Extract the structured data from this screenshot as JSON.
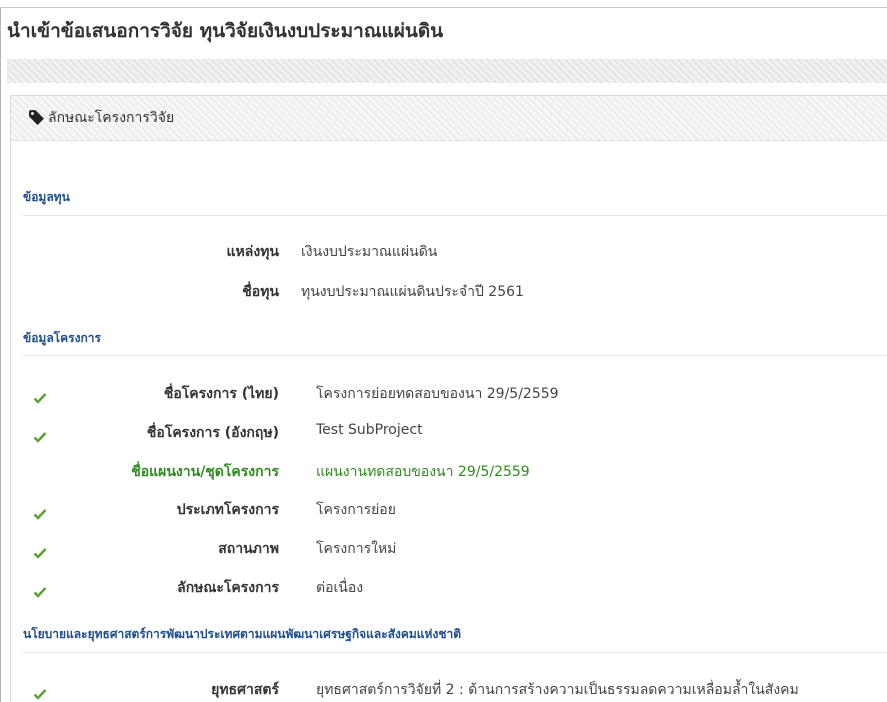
{
  "page": {
    "title": "นำเข้าข้อเสนอการวิจัย ทุนวิจัยเงินงบประมาณแผ่นดิน"
  },
  "card": {
    "title": "ลักษณะโครงการวิจัย",
    "icon": "tag-icon"
  },
  "funding": {
    "section_title": "ข้อมูลทุน",
    "rows": [
      {
        "label": "แหล่งทุน",
        "value": "เงินงบประมาณแผ่นดิน"
      },
      {
        "label": "ชื่อทุน",
        "value": "ทุนงบประมาณแผ่นดินประจำปี 2561"
      }
    ]
  },
  "project": {
    "section_title": "ข้อมูลโครงการ",
    "rows": [
      {
        "label": "ชื่อโครงการ (ไทย)",
        "value": "โครงการย่อยทดสอบของนา 29/5/2559",
        "checked": true
      },
      {
        "label": "ชื่อโครงการ (อังกฤษ)",
        "value": "Test SubProject",
        "checked": true
      },
      {
        "label": "ชื่อแผนงาน/ชุดโครงการ",
        "value": "แผนงานทดสอบของนา 29/5/2559",
        "checked": false,
        "highlight": "#2e8b1e"
      },
      {
        "label": "ประเภทโครงการ",
        "value": "โครงการย่อย",
        "checked": true
      },
      {
        "label": "สถานภาพ",
        "value": "โครงการใหม่",
        "checked": true
      },
      {
        "label": "ลักษณะโครงการ",
        "value": "ต่อเนื่อง",
        "checked": true
      }
    ]
  },
  "policy": {
    "section_title": "นโยบายและยุทธศาสตร์การพัฒนาประเทศตามแผนพัฒนาเศรษฐกิจและสังคมแห่งชาติ",
    "rows": [
      {
        "label": "ยุทธศาสตร์",
        "value": "ยุทธศาสตร์การวิจัยที่ 2 : ด้านการสร้างความเป็นธรรมลดความเหลื่อมล้ำในสังคม",
        "checked": true
      }
    ]
  },
  "colors": {
    "section_title": "#1f4f8f",
    "check": "#5aa02c",
    "highlight": "#2e8b1e"
  }
}
